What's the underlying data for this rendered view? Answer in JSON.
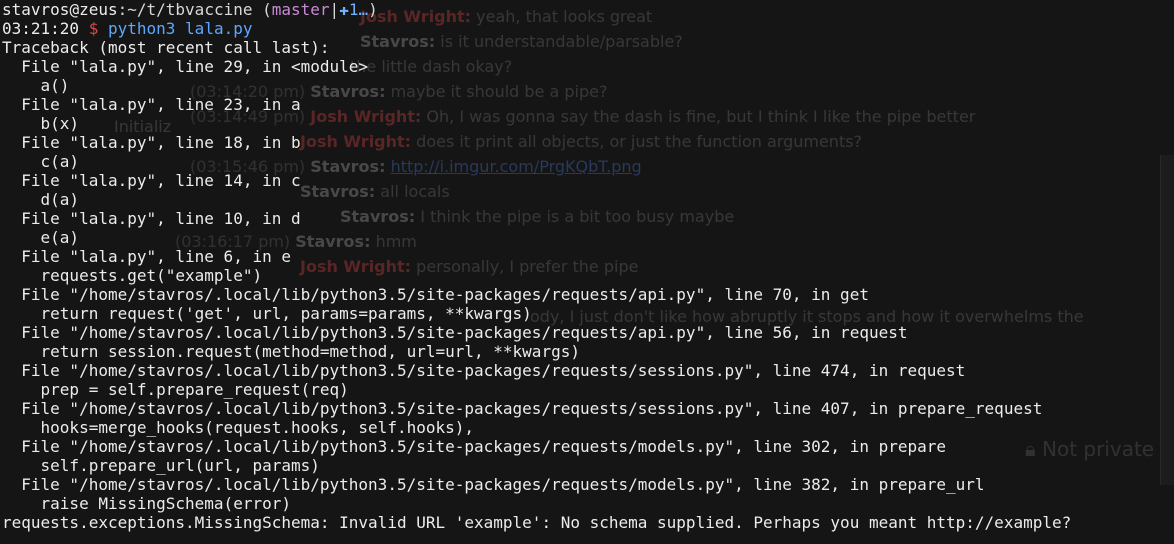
{
  "prompt": {
    "user": "stavros",
    "host": "zeus",
    "path": "~/t/tbvaccine",
    "branch": "master",
    "git_status": "✚1…",
    "time": "03:21:20",
    "symbol": "$",
    "command": "python3 lala.py"
  },
  "traceback": {
    "header": "Traceback (most recent call last):",
    "frames": [
      {
        "file_line": "  File \"lala.py\", line 29, in <module>",
        "code": "    a()"
      },
      {
        "file_line": "  File \"lala.py\", line 23, in a",
        "code": "    b(x)"
      },
      {
        "file_line": "  File \"lala.py\", line 18, in b",
        "code": "    c(a)"
      },
      {
        "file_line": "  File \"lala.py\", line 14, in c",
        "code": "    d(a)"
      },
      {
        "file_line": "  File \"lala.py\", line 10, in d",
        "code": "    e(a)"
      },
      {
        "file_line": "  File \"lala.py\", line 6, in e",
        "code": "    requests.get(\"example\")"
      },
      {
        "file_line": "  File \"/home/stavros/.local/lib/python3.5/site-packages/requests/api.py\", line 70, in get",
        "code": "    return request('get', url, params=params, **kwargs)"
      },
      {
        "file_line": "  File \"/home/stavros/.local/lib/python3.5/site-packages/requests/api.py\", line 56, in request",
        "code": "    return session.request(method=method, url=url, **kwargs)"
      },
      {
        "file_line": "  File \"/home/stavros/.local/lib/python3.5/site-packages/requests/sessions.py\", line 474, in request",
        "code": "    prep = self.prepare_request(req)"
      },
      {
        "file_line": "  File \"/home/stavros/.local/lib/python3.5/site-packages/requests/sessions.py\", line 407, in prepare_request",
        "code": "    hooks=merge_hooks(request.hooks, self.hooks),"
      },
      {
        "file_line": "  File \"/home/stavros/.local/lib/python3.5/site-packages/requests/models.py\", line 302, in prepare",
        "code": "    self.prepare_url(url, params)"
      },
      {
        "file_line": "  File \"/home/stavros/.local/lib/python3.5/site-packages/requests/models.py\", line 382, in prepare_url",
        "code": "    raise MissingSchema(error)"
      }
    ],
    "exception": "requests.exceptions.MissingSchema: Invalid URL 'example': No schema supplied. Perhaps you meant http://example?"
  },
  "background_chat": {
    "messages": [
      {
        "ts": "",
        "nick": "Josh Wright:",
        "text": "yeah, that looks great"
      },
      {
        "ts": "",
        "nick": "Stavros:",
        "text": "is it understandable/parsable?"
      },
      {
        "ts": "",
        "nick": "",
        "text": "the little dash okay?"
      },
      {
        "ts": "(03:14:20 pm)",
        "nick": "Stavros:",
        "text": "maybe it should be a pipe?"
      },
      {
        "ts": "(03:14:49 pm)",
        "nick": "Josh Wright:",
        "text": "Oh, I was gonna say the dash is fine, but I think I like the pipe better"
      },
      {
        "ts": "",
        "nick": "Josh Wright:",
        "text": "does it print all objects, or just the function arguments?"
      },
      {
        "ts": "(03:15:46 pm)",
        "nick": "Stavros:",
        "text": "http://i.imgur.com/PrgKQbT.png"
      },
      {
        "ts": "",
        "nick": "Stavros:",
        "text": "all locals"
      },
      {
        "ts": "",
        "nick": "Stavros:",
        "text": "I think the pipe is a bit too busy maybe"
      },
      {
        "ts": "(03:16:17 pm)",
        "nick": "Stavros:",
        "text": "hmm"
      },
      {
        "ts": "",
        "nick": "Josh Wright:",
        "text": "personally, I prefer the pipe"
      },
      {
        "ts": "",
        "nick": "",
        "text": "ody, I just don't like how abruptly it stops and how it overwhelms the"
      }
    ],
    "side_label": "Initializ",
    "status_text": "Not private"
  },
  "colors": {
    "background": "#151515",
    "text": "#ececec",
    "branch": "#c78bd6",
    "prompt_symbol": "#e04848",
    "command": "#5da8ff"
  }
}
